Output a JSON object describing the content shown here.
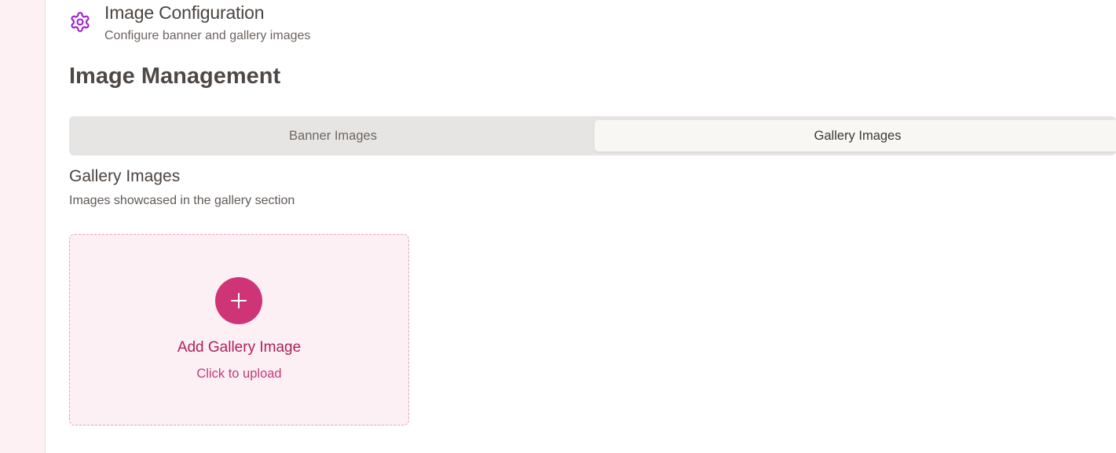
{
  "section": {
    "icon": "gear-icon",
    "title": "Image Configuration",
    "subtitle": "Configure banner and gallery images"
  },
  "page_title": "Image Management",
  "tabs": [
    {
      "label": "Banner Images",
      "active": false
    },
    {
      "label": "Gallery Images",
      "active": true
    }
  ],
  "gallery": {
    "title": "Gallery Images",
    "description": "Images showcased in the gallery section",
    "upload_card": {
      "icon": "plus-icon",
      "label": "Add Gallery Image",
      "hint": "Click to upload"
    }
  },
  "colors": {
    "accent": "#cf3477",
    "accent_text": "#ad1f5c",
    "icon_purple": "#9b1fd1",
    "card_bg": "#fcf0f5",
    "card_border": "#ec9fc0",
    "rail_bg": "#fdf1f3"
  }
}
